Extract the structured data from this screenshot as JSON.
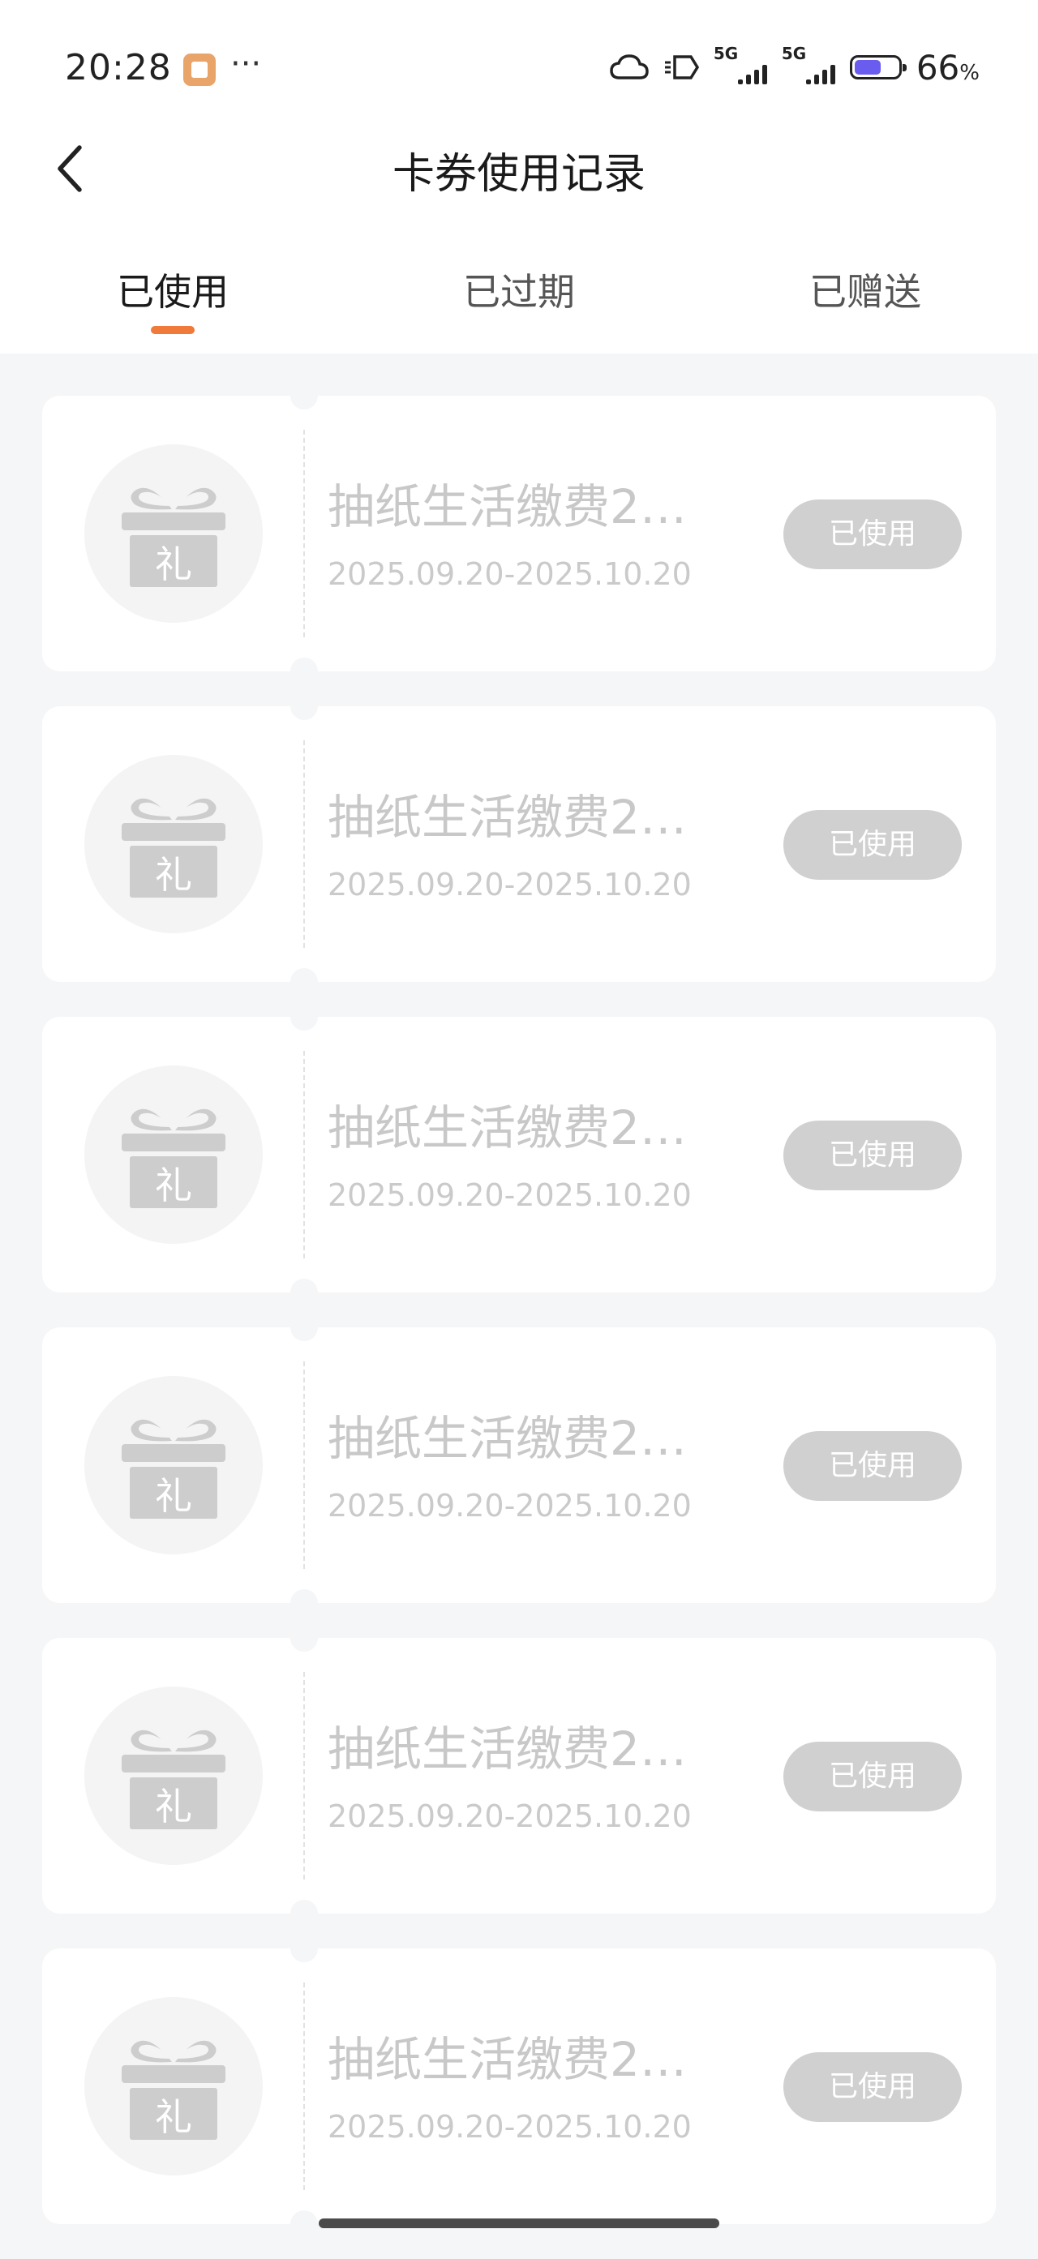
{
  "status_bar": {
    "time": "20:28",
    "dots": "···",
    "network_1": "5G",
    "network_2": "5G",
    "battery_level": 0.66,
    "battery_text": "66",
    "battery_unit": "%",
    "icons": [
      "app-notification-icon",
      "cloud-icon",
      "nfc-icon",
      "signal-icon",
      "signal-icon",
      "battery-icon"
    ]
  },
  "header": {
    "back_icon": "chevron-left-icon",
    "title": "卡券使用记录"
  },
  "tabs": [
    {
      "label": "已使用",
      "active": true
    },
    {
      "label": "已过期",
      "active": false
    },
    {
      "label": "已赠送",
      "active": false
    }
  ],
  "accent_color": "#ef7a3a",
  "coupons": [
    {
      "icon_text": "礼",
      "name": "抽纸生活缴费2…",
      "date": "2025.09.20-2025.10.20",
      "button": "已使用"
    },
    {
      "icon_text": "礼",
      "name": "抽纸生活缴费2…",
      "date": "2025.09.20-2025.10.20",
      "button": "已使用"
    },
    {
      "icon_text": "礼",
      "name": "抽纸生活缴费2…",
      "date": "2025.09.20-2025.10.20",
      "button": "已使用"
    },
    {
      "icon_text": "礼",
      "name": "抽纸生活缴费2…",
      "date": "2025.09.20-2025.10.20",
      "button": "已使用"
    },
    {
      "icon_text": "礼",
      "name": "抽纸生活缴费2…",
      "date": "2025.09.20-2025.10.20",
      "button": "已使用"
    },
    {
      "icon_text": "礼",
      "name": "抽纸生活缴费2…",
      "date": "2025.09.20-2025.10.20",
      "button": "已使用"
    }
  ]
}
